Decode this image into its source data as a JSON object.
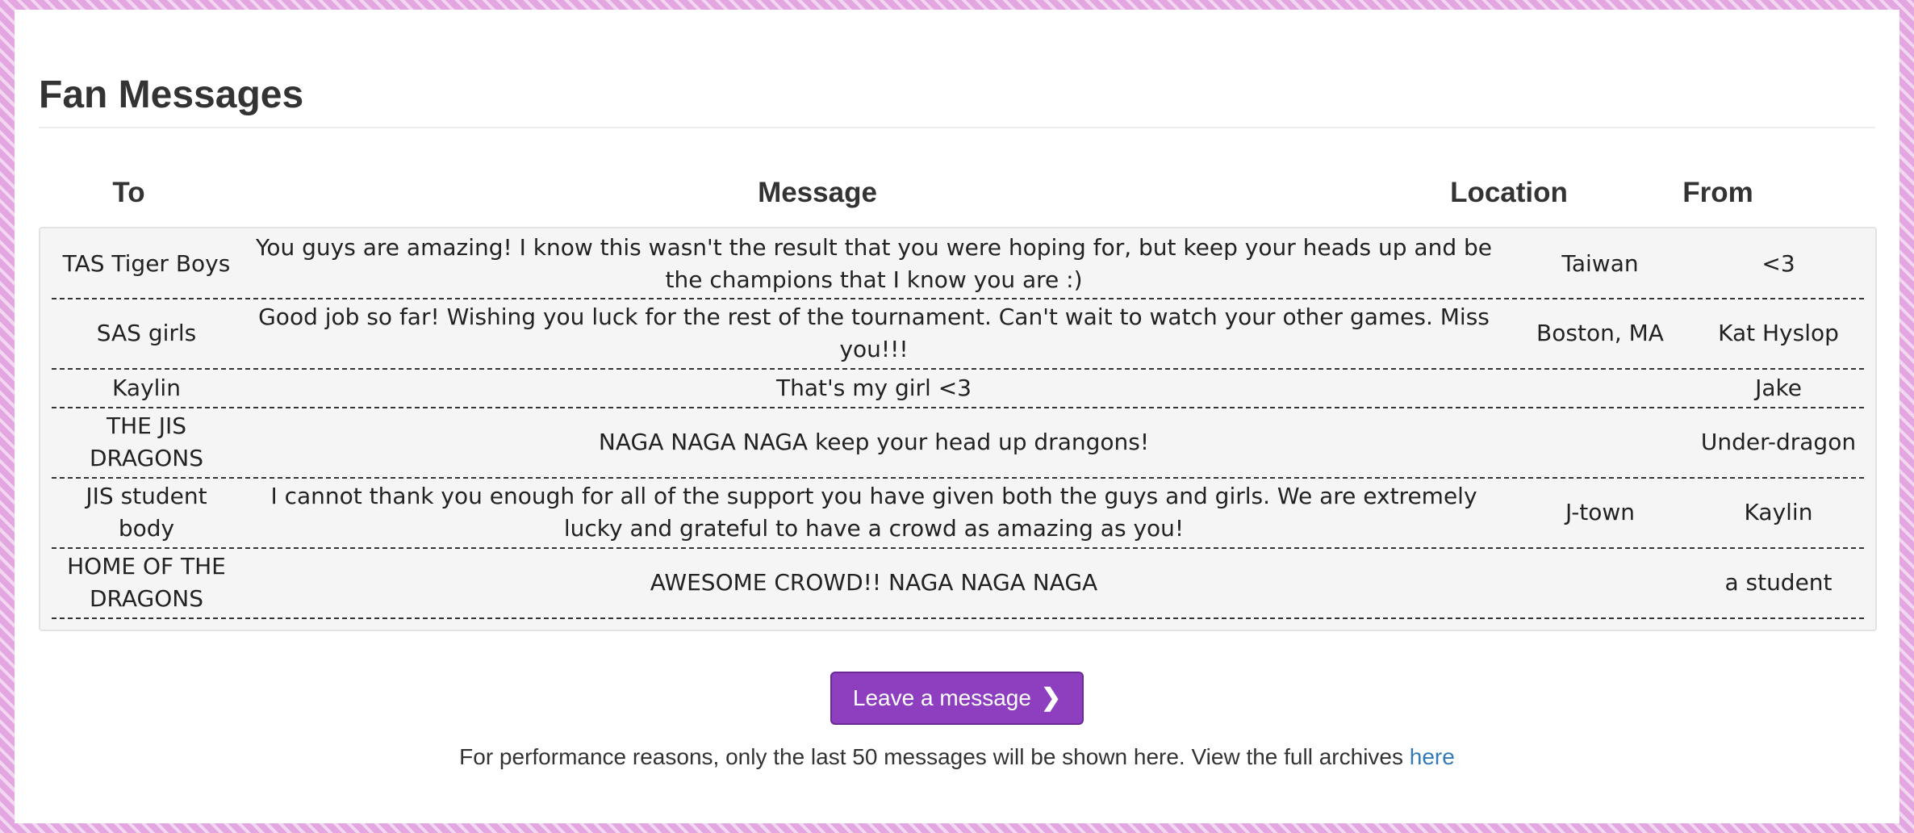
{
  "page": {
    "title": "Fan Messages"
  },
  "table": {
    "headers": {
      "to": "To",
      "message": "Message",
      "location": "Location",
      "from": "From"
    },
    "rows": [
      {
        "to": "TAS Tiger Boys",
        "message": "You guys are amazing! I know this wasn't the result that you were hoping for, but keep your heads up and be the champions that I know you are :)",
        "location": "Taiwan",
        "from": "<3"
      },
      {
        "to": "SAS girls",
        "message": "Good job so far! Wishing you luck for the rest of the tournament. Can't wait to watch your other games. Miss you!!!",
        "location": "Boston, MA",
        "from": "Kat Hyslop"
      },
      {
        "to": "Kaylin",
        "message": "That's my girl <3",
        "location": "",
        "from": "Jake"
      },
      {
        "to": "THE JIS DRAGONS",
        "message": "NAGA NAGA NAGA keep your head up drangons!",
        "location": "",
        "from": "Under-dragon"
      },
      {
        "to": "JIS student body",
        "message": "I cannot thank you enough for all of the support you have given both the guys and girls. We are extremely lucky and grateful to have a crowd as amazing as you!",
        "location": "J-town",
        "from": "Kaylin"
      },
      {
        "to": "HOME OF THE DRAGONS",
        "message": "AWESOME CROWD!! NAGA NAGA NAGA",
        "location": "",
        "from": "a student"
      }
    ]
  },
  "actions": {
    "leave_message_label": "Leave a message",
    "chevron_icon": "chevron-right-icon"
  },
  "footer": {
    "note": "For performance reasons, only the last 50 messages will be shown here. View the full archives ",
    "link_label": "here"
  },
  "colors": {
    "accent": "#8e3fc0",
    "link": "#337ab7",
    "border": "#e3a6e0"
  }
}
